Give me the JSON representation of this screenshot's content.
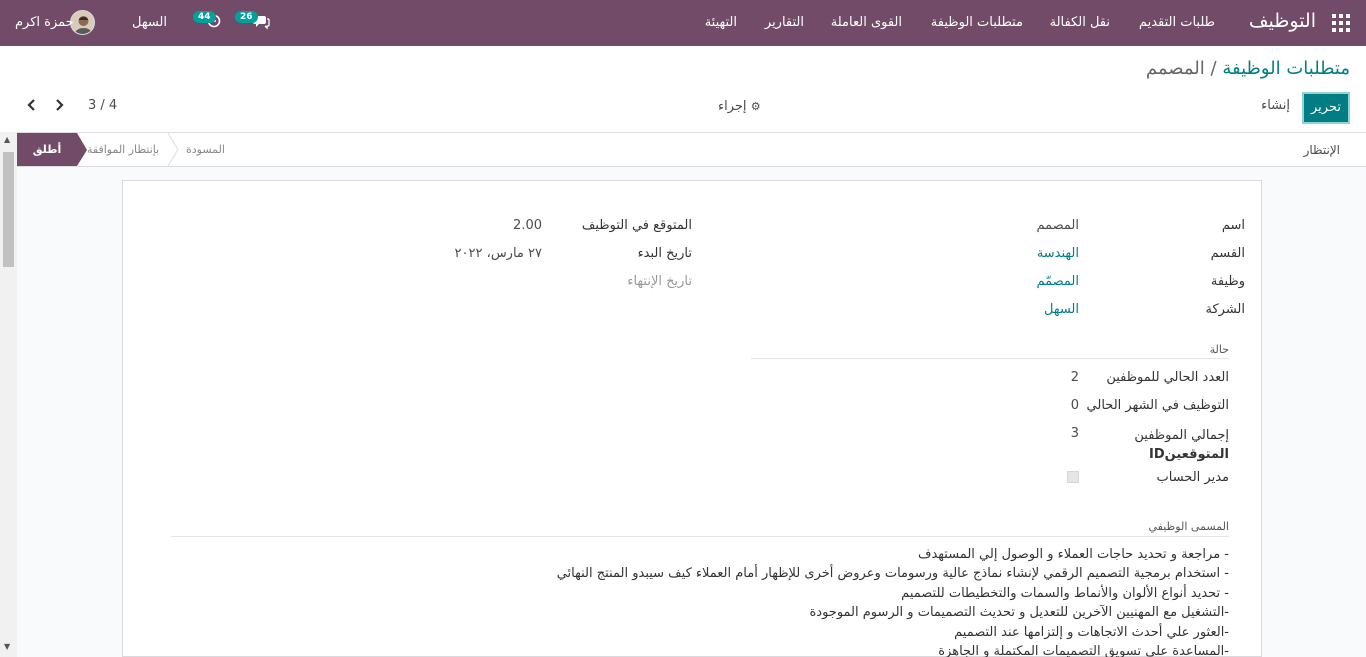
{
  "navbar": {
    "brand": "التوظيف",
    "menu": [
      "طلبات التقديم",
      "نقل الكفالة",
      "متطلبات الوظيفة",
      "القوى العاملة",
      "التقارير",
      "التهيئة"
    ],
    "messages_count": "26",
    "activities_count": "44",
    "company": "السهل",
    "user": "حمزة اكرم"
  },
  "control": {
    "breadcrumb_parent": "متطلبات الوظيفة",
    "breadcrumb_sep": " / ",
    "breadcrumb_current": "المصمم",
    "edit_label": "تحرير",
    "create_label": "إنشاء",
    "action_label": "إجراء",
    "pager": "3 / 4"
  },
  "statusbar": {
    "button_label": "الإنتظار",
    "stages": [
      "المسودة",
      "بإنتظار الموافقة",
      "أطلق"
    ],
    "active_stage": "أطلق"
  },
  "form": {
    "fields_right": [
      {
        "label": "اسم",
        "value": "المصمم",
        "style": "plain"
      },
      {
        "label": "القسم",
        "value": "الهندسة",
        "style": "link"
      },
      {
        "label": "وظيفة",
        "value": "المصمّم",
        "style": "link"
      },
      {
        "label": "الشركة",
        "value": "السهل",
        "style": "link"
      }
    ],
    "fields_left": [
      {
        "label": "المتوقع في التوظيف",
        "value": "2.00"
      },
      {
        "label": "تاريخ البدء",
        "value": "٢٧ مارس، ٢٠٢٢"
      },
      {
        "label": "تاريخ الإنتهاء",
        "value": ""
      }
    ],
    "status_title": "حالة",
    "status_fields": [
      {
        "label": "العدد الحالي للموظفين",
        "value": "2"
      },
      {
        "label": "التوظيف في الشهر الحالي",
        "value": "0"
      },
      {
        "label_line1": "إجمالي الموظفين",
        "label_line2": "المتوقعينID",
        "value": "3"
      },
      {
        "label": "مدير الحساب",
        "value": ""
      }
    ],
    "job_title_section": "المسمى الوظيفي",
    "description": [
      "- مراجعة و تحديد حاجات العملاء و الوصول إلي المستهدف",
      "- استخدام برمجية التصميم الرقمي لإنشاء نماذج عالية ورسومات وعروض أخرى للإظهار أمام العملاء كيف سيبدو  المنتج النهائي",
      "- تحديد أنواع الألوان والأنماط والسمات والتخطيطات للتصميم",
      "-التشغيل مع المهنيين الآخرين للتعديل و تحديث التصميمات و الرسوم الموجودة",
      "-العثور علي أحدث الاتجاهات و إلتزامها عند التصميم",
      "-المساعدة علي تسويق التصميمات المكتملة و الجاهزة"
    ]
  },
  "colors": {
    "brand": "#714b67",
    "accent": "#017e84"
  }
}
